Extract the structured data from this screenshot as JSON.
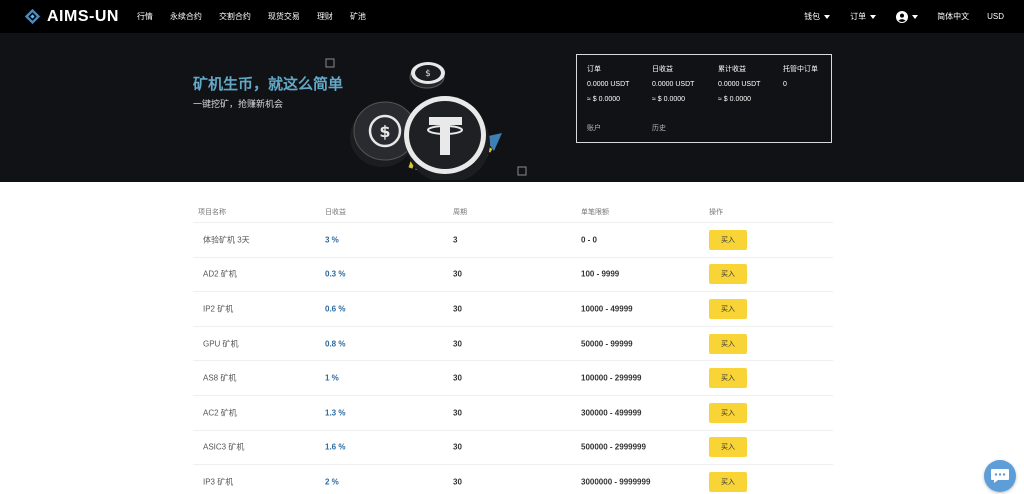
{
  "brand": {
    "name": "AIMS-UN"
  },
  "nav": {
    "items": [
      "行情",
      "永续合约",
      "交割合约",
      "现货交易",
      "理财",
      "矿池"
    ]
  },
  "nav_right": {
    "wallet": "钱包",
    "orders": "订单",
    "language": "简体中文",
    "currency": "USD"
  },
  "hero": {
    "title": "矿机生币，就这么简单",
    "subtitle": "一键挖矿，抢赚新机会"
  },
  "stats": {
    "columns": [
      {
        "label": "订单",
        "value1": "0.0000 USDT",
        "value2": "≈ $ 0.0000"
      },
      {
        "label": "日收益",
        "value1": "0.0000 USDT",
        "value2": "≈ $ 0.0000"
      },
      {
        "label": "累计收益",
        "value1": "0.0000 USDT",
        "value2": "≈ $ 0.0000"
      },
      {
        "label": "托管中订单",
        "value1": "0",
        "value2": ""
      }
    ],
    "links": {
      "account": "账户",
      "history": "历史"
    }
  },
  "table": {
    "headers": [
      "项目名称",
      "日收益",
      "周期",
      "单笔限额",
      "操作"
    ],
    "rows": [
      {
        "name": "体验矿机 3天",
        "rate": "3 %",
        "period": "3",
        "limit": "0 - 0",
        "action": "买入"
      },
      {
        "name": "AD2 矿机",
        "rate": "0.3 %",
        "period": "30",
        "limit": "100 - 9999",
        "action": "买入"
      },
      {
        "name": "IP2 矿机",
        "rate": "0.6 %",
        "period": "30",
        "limit": "10000 - 49999",
        "action": "买入"
      },
      {
        "name": "GPU 矿机",
        "rate": "0.8 %",
        "period": "30",
        "limit": "50000 - 99999",
        "action": "买入"
      },
      {
        "name": "AS8 矿机",
        "rate": "1 %",
        "period": "30",
        "limit": "100000 - 299999",
        "action": "买入"
      },
      {
        "name": "AC2 矿机",
        "rate": "1.3 %",
        "period": "30",
        "limit": "300000 - 499999",
        "action": "买入"
      },
      {
        "name": "ASIC3 矿机",
        "rate": "1.6 %",
        "period": "30",
        "limit": "500000 - 2999999",
        "action": "买入"
      },
      {
        "name": "IP3 矿机",
        "rate": "2 %",
        "period": "30",
        "limit": "3000000 - 9999999",
        "action": "买入"
      }
    ]
  },
  "colors": {
    "nav_bg": "#000000",
    "hero_bg": "#111216",
    "hero_title": "#63a9c7",
    "rate_text": "#2b6aa0",
    "buy_button": "#f9d437",
    "chat_widget": "#5e9ed8"
  },
  "icons": {
    "logo": "diamond-logo-icon",
    "user": "user-circle-icon",
    "dropdown": "caret-down-icon",
    "chat": "chat-bubble-icon"
  }
}
